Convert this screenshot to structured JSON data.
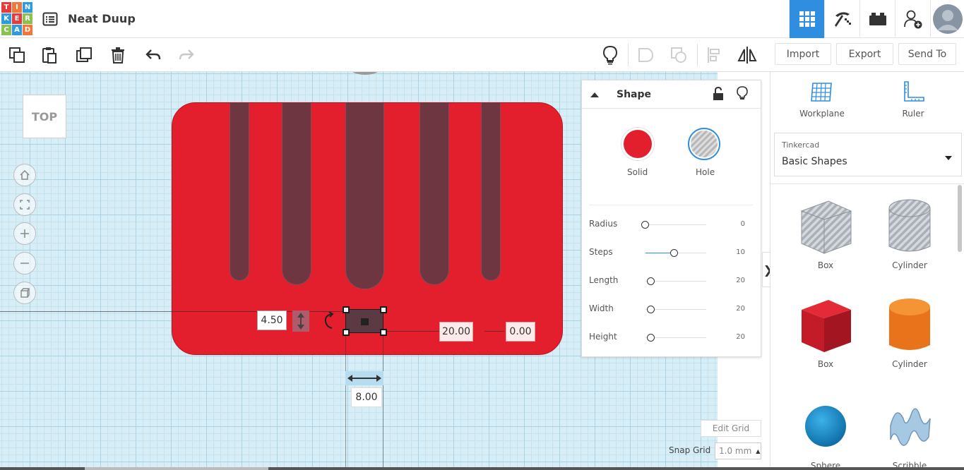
{
  "app": {
    "logo_letters": [
      "T",
      "I",
      "N",
      "K",
      "E",
      "R",
      "C",
      "A",
      "D"
    ],
    "document_title": "Neat Duup"
  },
  "top_nav": {
    "items": [
      "3d-view-grid-icon",
      "pickaxe-icon",
      "bricks-icon",
      "add-user-icon",
      "user-avatar"
    ],
    "active": "3d-view-grid-icon",
    "accent_color": "#2f8ee0"
  },
  "toolbar": {
    "import_label": "Import",
    "export_label": "Export",
    "send_to_label": "Send To"
  },
  "canvas": {
    "viewcube_label": "TOP",
    "plate_color": "#e31e2d",
    "dimensions": {
      "rotation_value": "4.50",
      "x_offset_value": "20.00",
      "y_offset_value": "0.00",
      "width_value": "8.00"
    },
    "edit_grid_label": "Edit Grid",
    "snap_grid_label": "Snap Grid",
    "snap_grid_value": "1.0 mm"
  },
  "inspector": {
    "title": "Shape",
    "solid_label": "Solid",
    "hole_label": "Hole",
    "solid_color": "#e31e2d",
    "params": [
      {
        "label": "Radius",
        "value": "0"
      },
      {
        "label": "Steps",
        "value": "10"
      },
      {
        "label": "Length",
        "value": "20"
      },
      {
        "label": "Width",
        "value": "20"
      },
      {
        "label": "Height",
        "value": "20"
      }
    ]
  },
  "sidebar": {
    "workplane_label": "Workplane",
    "ruler_label": "Ruler",
    "library_category": "Tinkercad",
    "library_name": "Basic Shapes",
    "shapes": [
      {
        "label": "Box",
        "kind": "hole"
      },
      {
        "label": "Cylinder",
        "kind": "hole"
      },
      {
        "label": "Box",
        "kind": "solid",
        "color": "#d01f2b"
      },
      {
        "label": "Cylinder",
        "kind": "solid",
        "color": "#f07a1c"
      },
      {
        "label": "Sphere",
        "kind": "solid",
        "color": "#1a8fd0"
      },
      {
        "label": "Scribble",
        "kind": "solid",
        "color": "#8fb8d8"
      }
    ]
  }
}
